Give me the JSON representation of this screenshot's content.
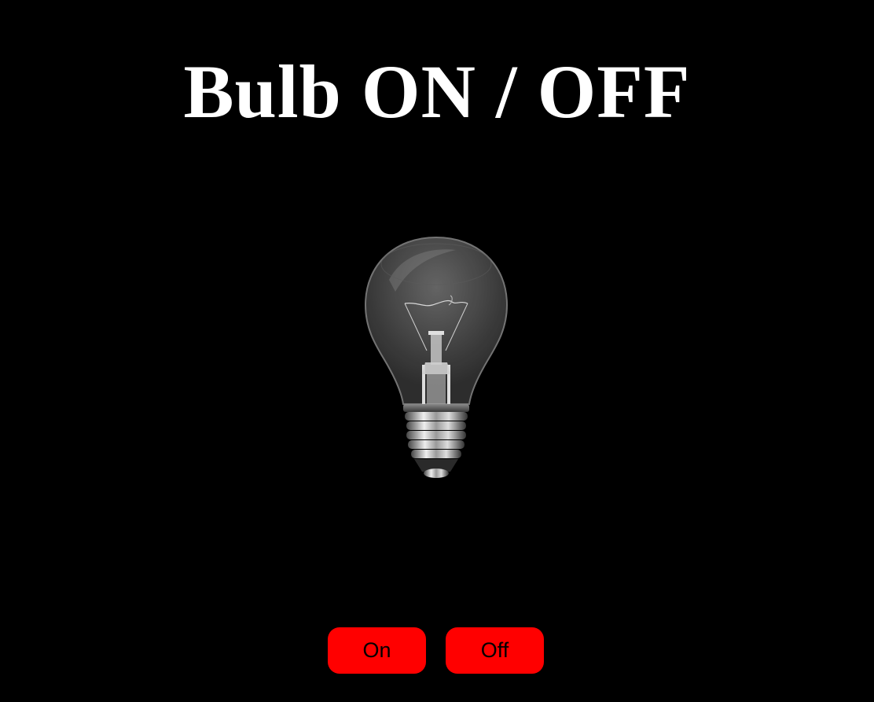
{
  "page": {
    "title": "Bulb ON / OFF",
    "background_color": "#000000"
  },
  "bulb": {
    "icon": "light-bulb-icon",
    "state": "off"
  },
  "controls": {
    "on_label": "On",
    "off_label": "Off",
    "button_color": "#ff0000"
  }
}
